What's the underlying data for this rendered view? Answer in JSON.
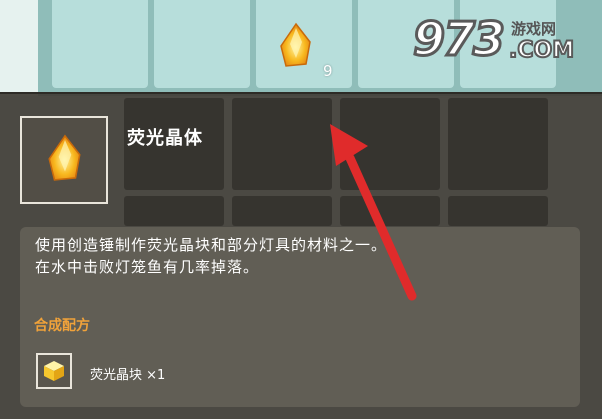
{
  "inventory": {
    "slot_quantity": "9",
    "item_icon": "fluorescent-crystal-icon"
  },
  "watermark": {
    "digits": "973",
    "chinese": "游戏网",
    "com": ".COM"
  },
  "tooltip": {
    "item_name": "荧光晶体",
    "item_icon": "fluorescent-crystal-icon",
    "description": [
      "使用创造锤制作荧光晶块和部分灯具的材料之一。",
      "在水中击败灯笼鱼有几率掉落。"
    ],
    "recipe_title": "合成配方",
    "recipe": {
      "icon": "fluorescent-block-icon",
      "label": "荧光晶块 ×1"
    }
  },
  "colors": {
    "recipe_title": "#f0a23a",
    "arrow": "#e02b2b",
    "panel": "#423f38",
    "crystal": "#f5b21a"
  },
  "annotation": {
    "icon": "red-arrow-icon"
  }
}
